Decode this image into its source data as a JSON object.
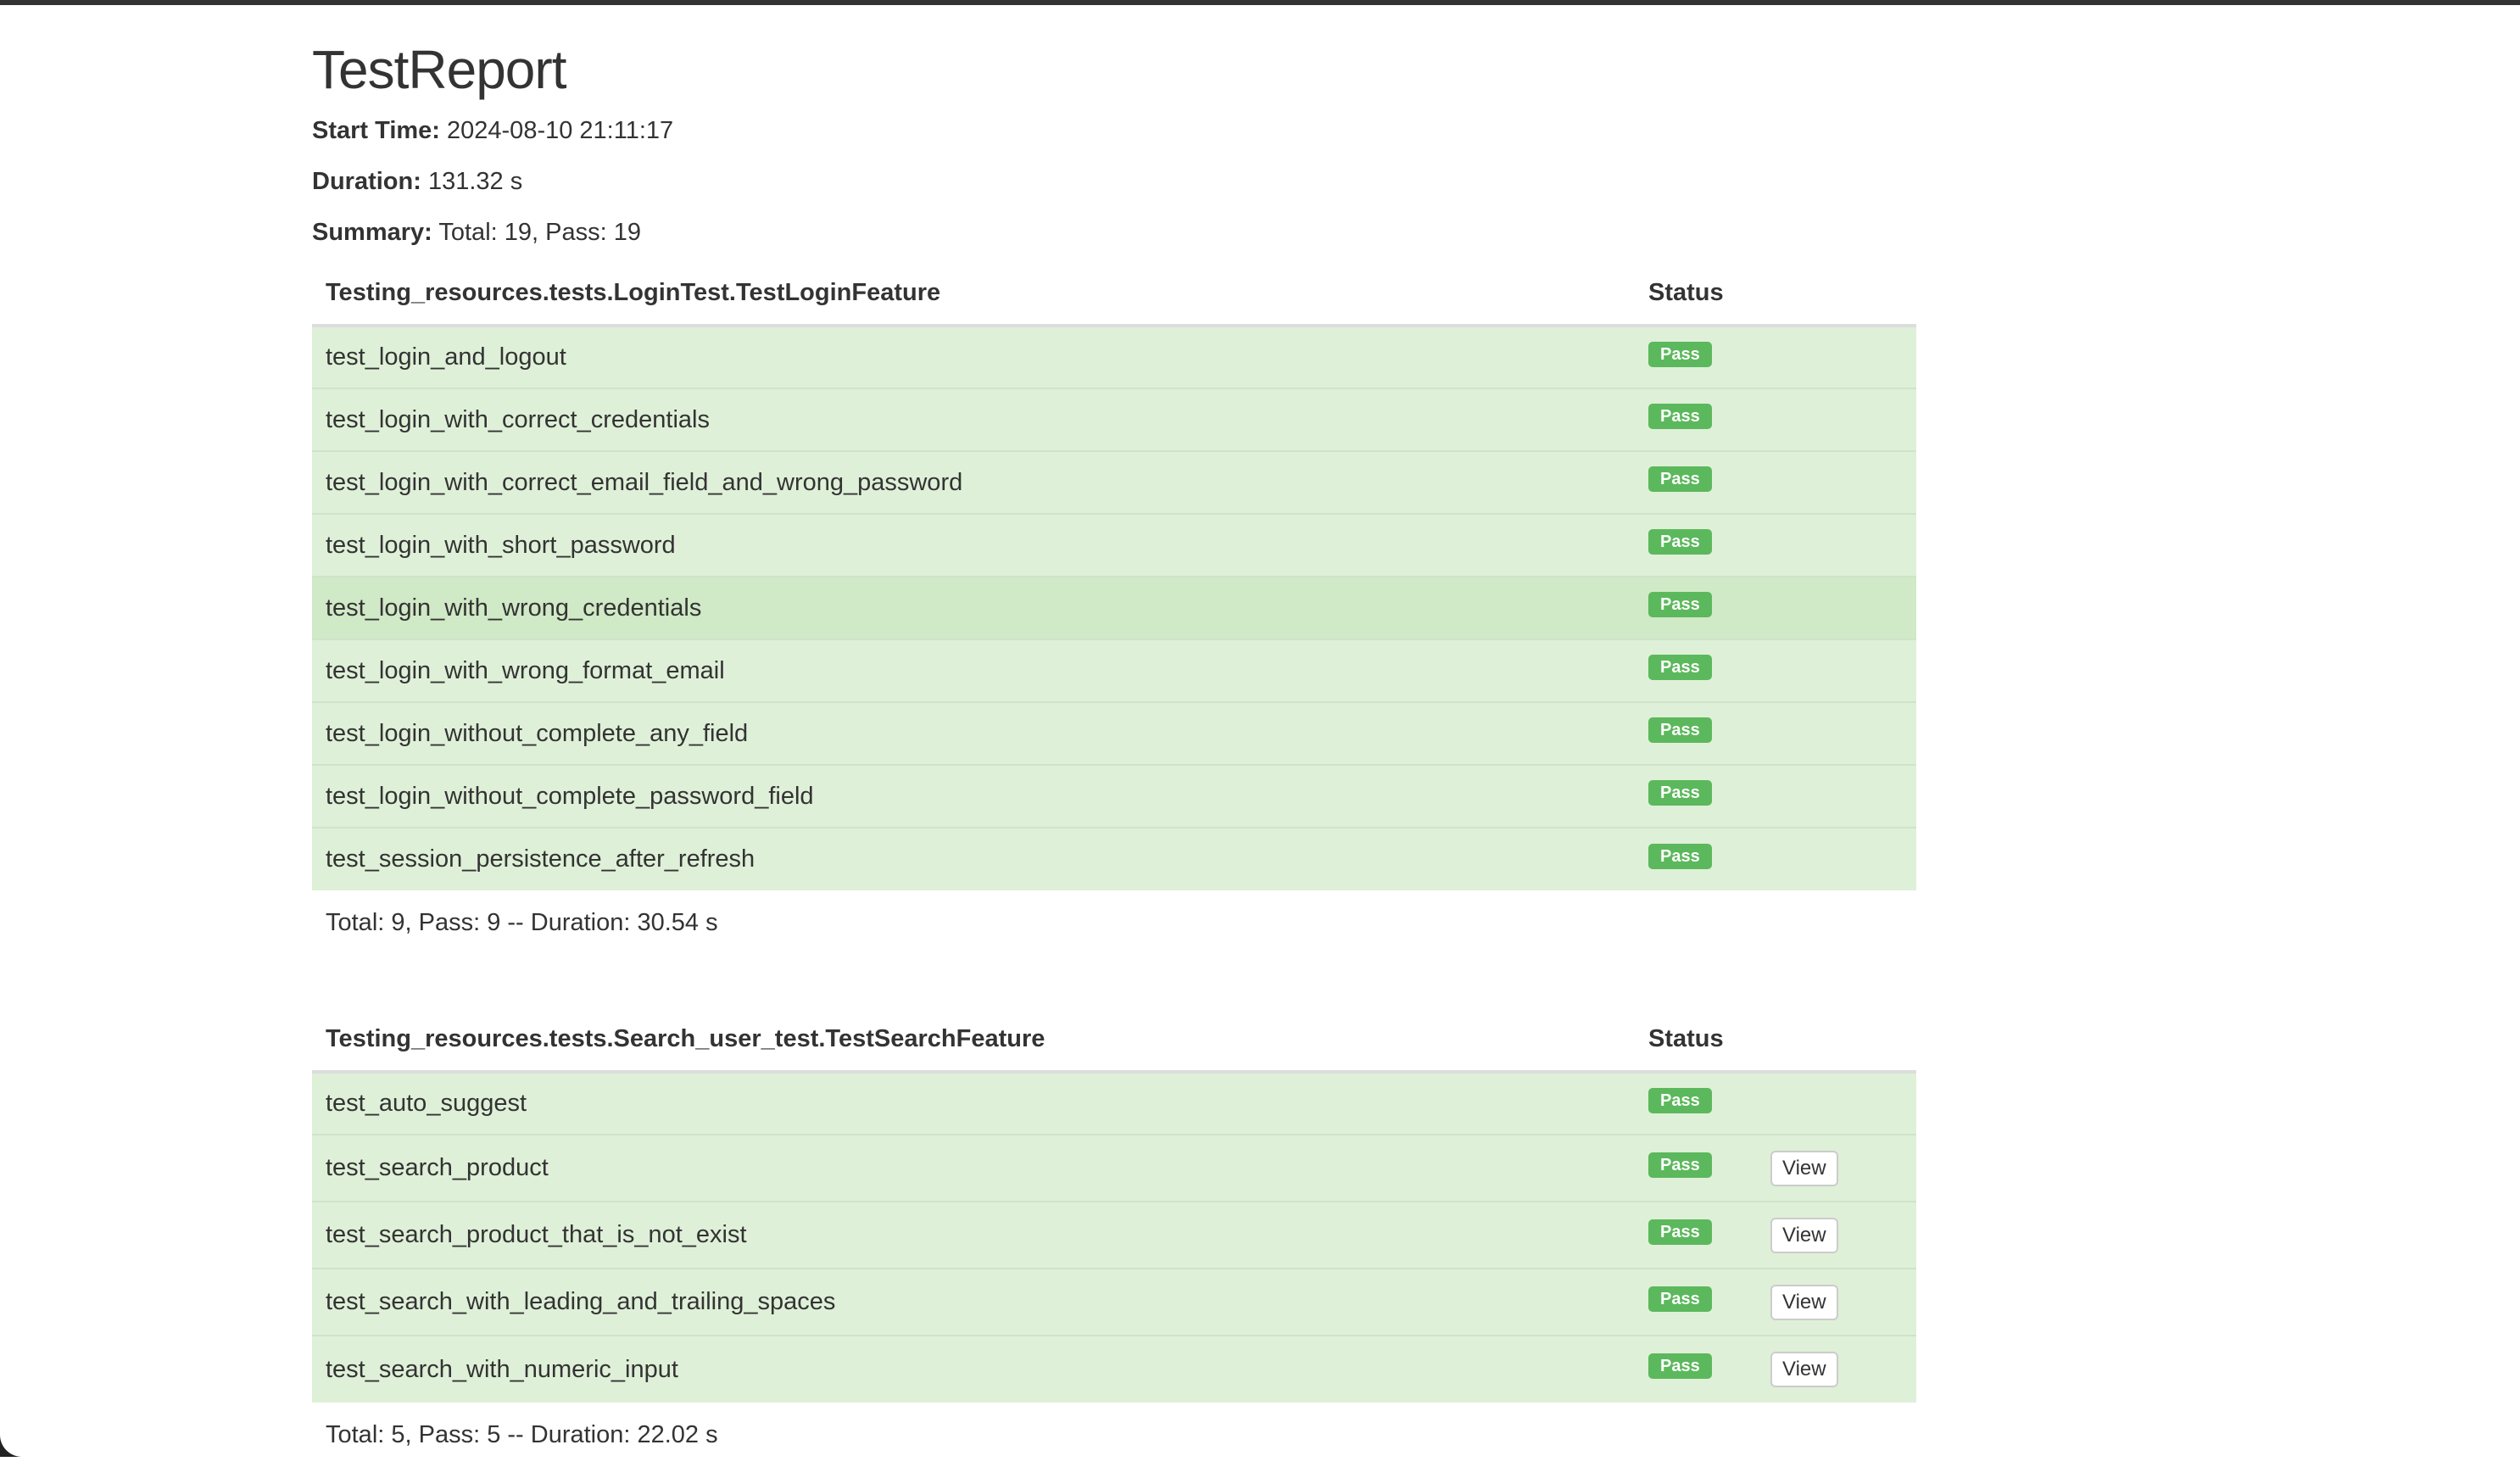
{
  "report": {
    "title": "TestReport",
    "start_time_label": "Start Time:",
    "start_time": "2024-08-10 21:11:17",
    "duration_label": "Duration:",
    "duration": "131.32 s",
    "summary_label": "Summary:",
    "summary": "Total: 19, Pass: 19"
  },
  "colors": {
    "pass_badge": "#5cb85c",
    "row_success": "#dff0d8",
    "row_hover": "#d0e9c6",
    "top_bar": "#333333"
  },
  "suites": [
    {
      "name": "Testing_resources.tests.LoginTest.TestLoginFeature",
      "status_header": "Status",
      "tests": [
        {
          "name": "test_login_and_logout",
          "status": "Pass"
        },
        {
          "name": "test_login_with_correct_credentials",
          "status": "Pass"
        },
        {
          "name": "test_login_with_correct_email_field_and_wrong_password",
          "status": "Pass"
        },
        {
          "name": "test_login_with_short_password",
          "status": "Pass"
        },
        {
          "name": "test_login_with_wrong_credentials",
          "status": "Pass"
        },
        {
          "name": "test_login_with_wrong_format_email",
          "status": "Pass"
        },
        {
          "name": "test_login_without_complete_any_field",
          "status": "Pass"
        },
        {
          "name": "test_login_without_complete_password_field",
          "status": "Pass"
        },
        {
          "name": "test_session_persistence_after_refresh",
          "status": "Pass"
        }
      ],
      "total": "Total: 9, Pass: 9 -- Duration: 30.54 s"
    },
    {
      "name": "Testing_resources.tests.Search_user_test.TestSearchFeature",
      "status_header": "Status",
      "tests": [
        {
          "name": "test_auto_suggest",
          "status": "Pass"
        },
        {
          "name": "test_search_product",
          "status": "Pass",
          "view": "View"
        },
        {
          "name": "test_search_product_that_is_not_exist",
          "status": "Pass",
          "view": "View"
        },
        {
          "name": "test_search_with_leading_and_trailing_spaces",
          "status": "Pass",
          "view": "View"
        },
        {
          "name": "test_search_with_numeric_input",
          "status": "Pass",
          "view": "View"
        }
      ],
      "total": "Total: 5, Pass: 5 -- Duration: 22.02 s"
    }
  ]
}
